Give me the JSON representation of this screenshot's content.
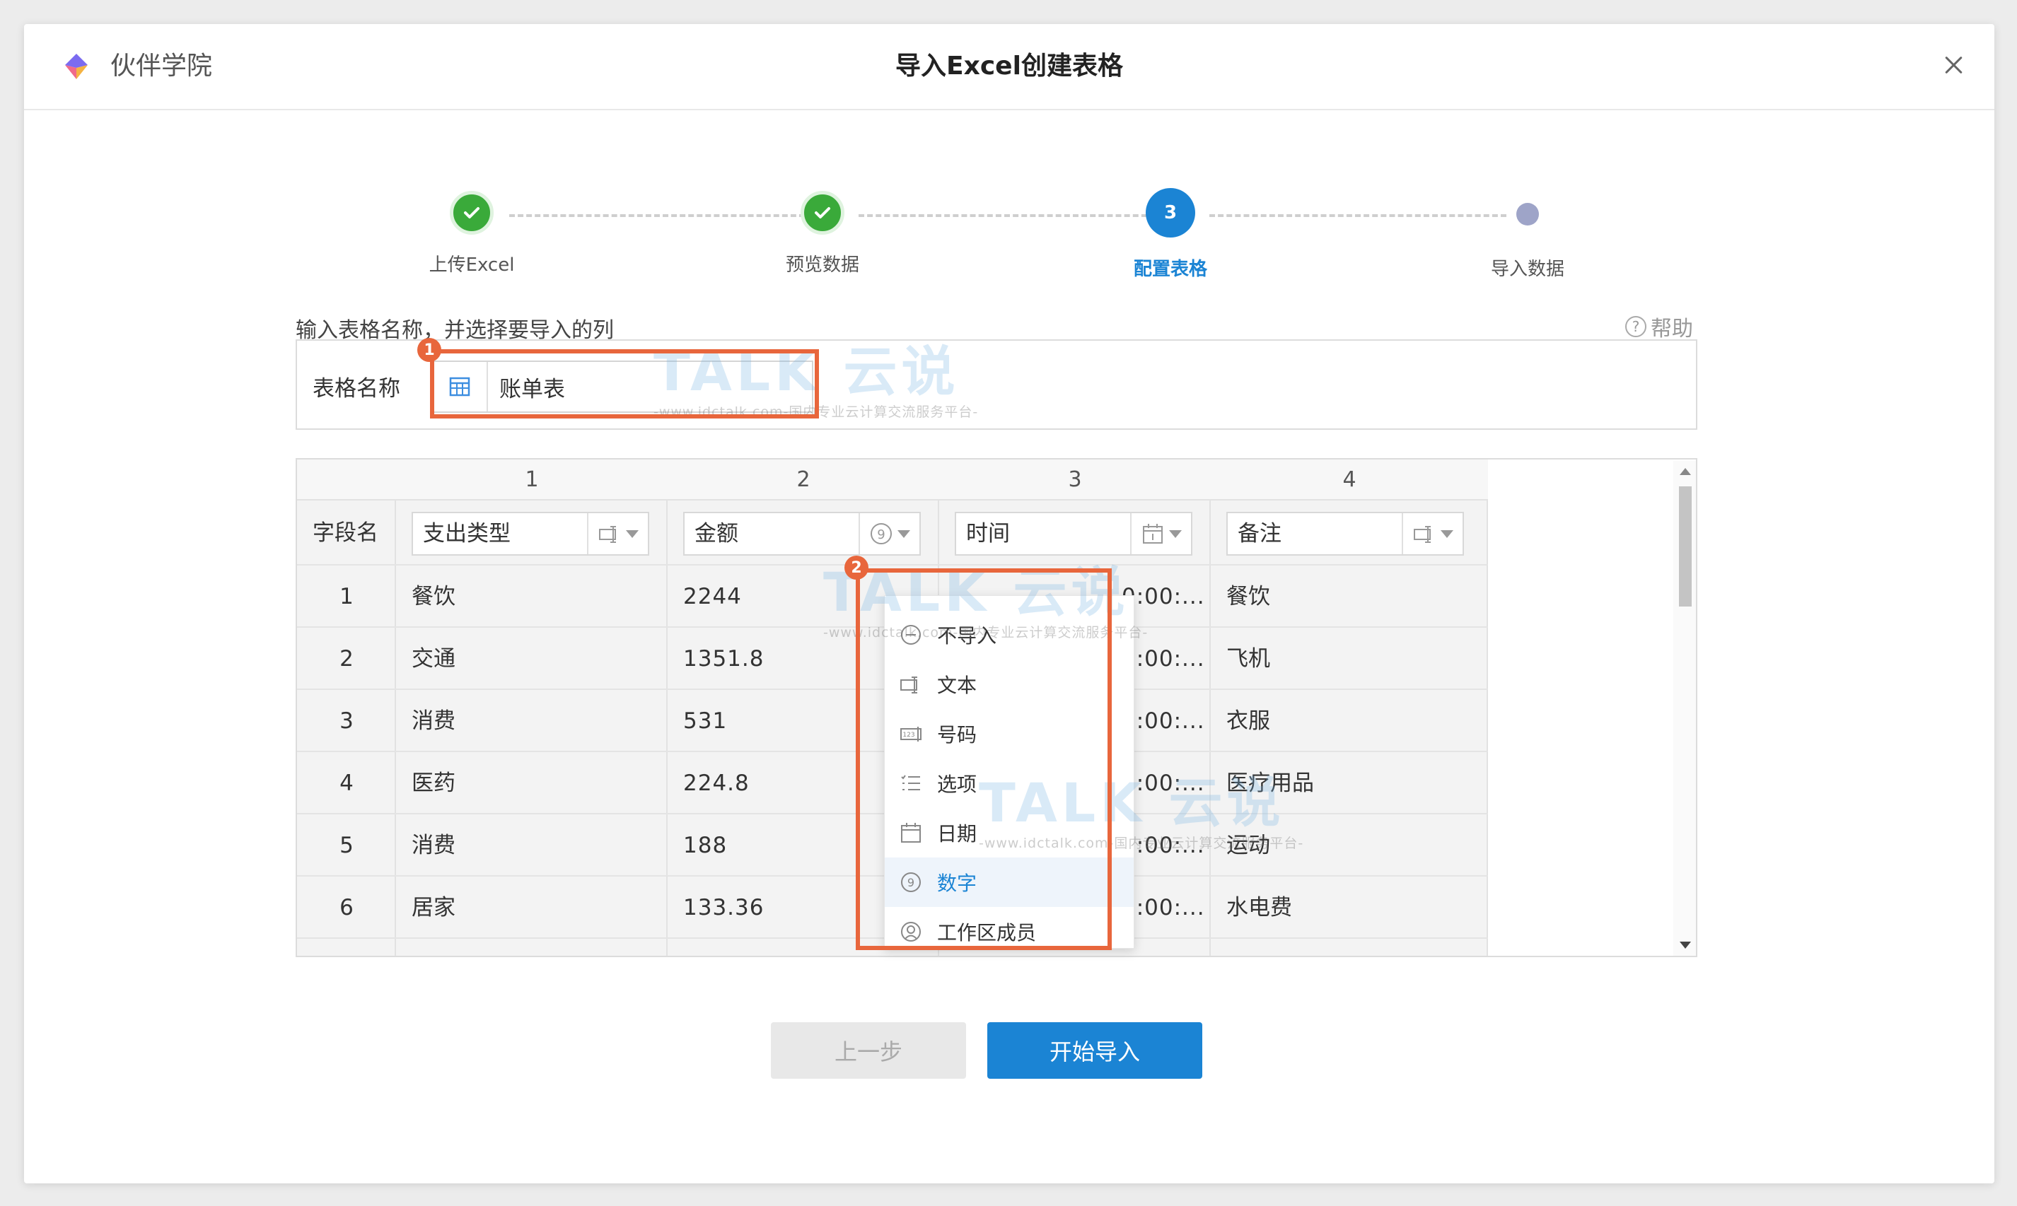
{
  "header": {
    "app_name": "伙伴学院",
    "title": "导入Excel创建表格",
    "colors": {
      "logo_top": "#7b6bf0",
      "logo_left": "#f06a8a",
      "logo_right": "#f5b342"
    }
  },
  "steps": [
    {
      "label": "上传Excel",
      "state": "done"
    },
    {
      "label": "预览数据",
      "state": "done"
    },
    {
      "label": "配置表格",
      "state": "current",
      "number": "3"
    },
    {
      "label": "导入数据",
      "state": "todo"
    }
  ],
  "instruction": "输入表格名称，并选择要导入的列",
  "help_label": "帮助",
  "table_name": {
    "label": "表格名称",
    "value": "账单表"
  },
  "annotations": {
    "badge1": "1",
    "badge2": "2"
  },
  "grid": {
    "col_numbers": [
      "1",
      "2",
      "3",
      "4"
    ],
    "field_row_label": "字段名",
    "fields": [
      {
        "name": "支出类型",
        "type_icon": "text-icon"
      },
      {
        "name": "金额",
        "type_icon": "number-icon"
      },
      {
        "name": "时间",
        "type_icon": "date-icon"
      },
      {
        "name": "备注",
        "type_icon": "text-icon"
      }
    ],
    "rows": [
      {
        "index": "1",
        "cells": [
          "餐饮",
          "2244",
          "0:00:...",
          "餐饮"
        ]
      },
      {
        "index": "2",
        "cells": [
          "交通",
          "1351.8",
          "0:00:...",
          "飞机"
        ]
      },
      {
        "index": "3",
        "cells": [
          "消费",
          "531",
          "0:00:...",
          "衣服"
        ]
      },
      {
        "index": "4",
        "cells": [
          "医药",
          "224.8",
          "0:00:...",
          "医疗用品"
        ]
      },
      {
        "index": "5",
        "cells": [
          "消费",
          "188",
          "0:00:...",
          "运动"
        ]
      },
      {
        "index": "6",
        "cells": [
          "居家",
          "133.36",
          "0:00:...",
          "水电费"
        ]
      }
    ]
  },
  "dropdown": {
    "selected": "数字",
    "options": [
      {
        "label": "不导入",
        "icon": "no-import-icon"
      },
      {
        "label": "文本",
        "icon": "text-icon"
      },
      {
        "label": "号码",
        "icon": "phone-number-icon"
      },
      {
        "label": "选项",
        "icon": "list-option-icon"
      },
      {
        "label": "日期",
        "icon": "calendar-icon"
      },
      {
        "label": "数字",
        "icon": "number-icon"
      },
      {
        "label": "工作区成员",
        "icon": "member-icon"
      }
    ]
  },
  "buttons": {
    "prev": "上一步",
    "start": "开始导入"
  },
  "watermark": {
    "brand": "TALK 云说",
    "tagline": "-www.idctalk.com-国内专业云计算交流服务平台-"
  },
  "colors": {
    "accent": "#1b84d4",
    "success": "#3aaa3a",
    "highlight": "#e8663c"
  }
}
